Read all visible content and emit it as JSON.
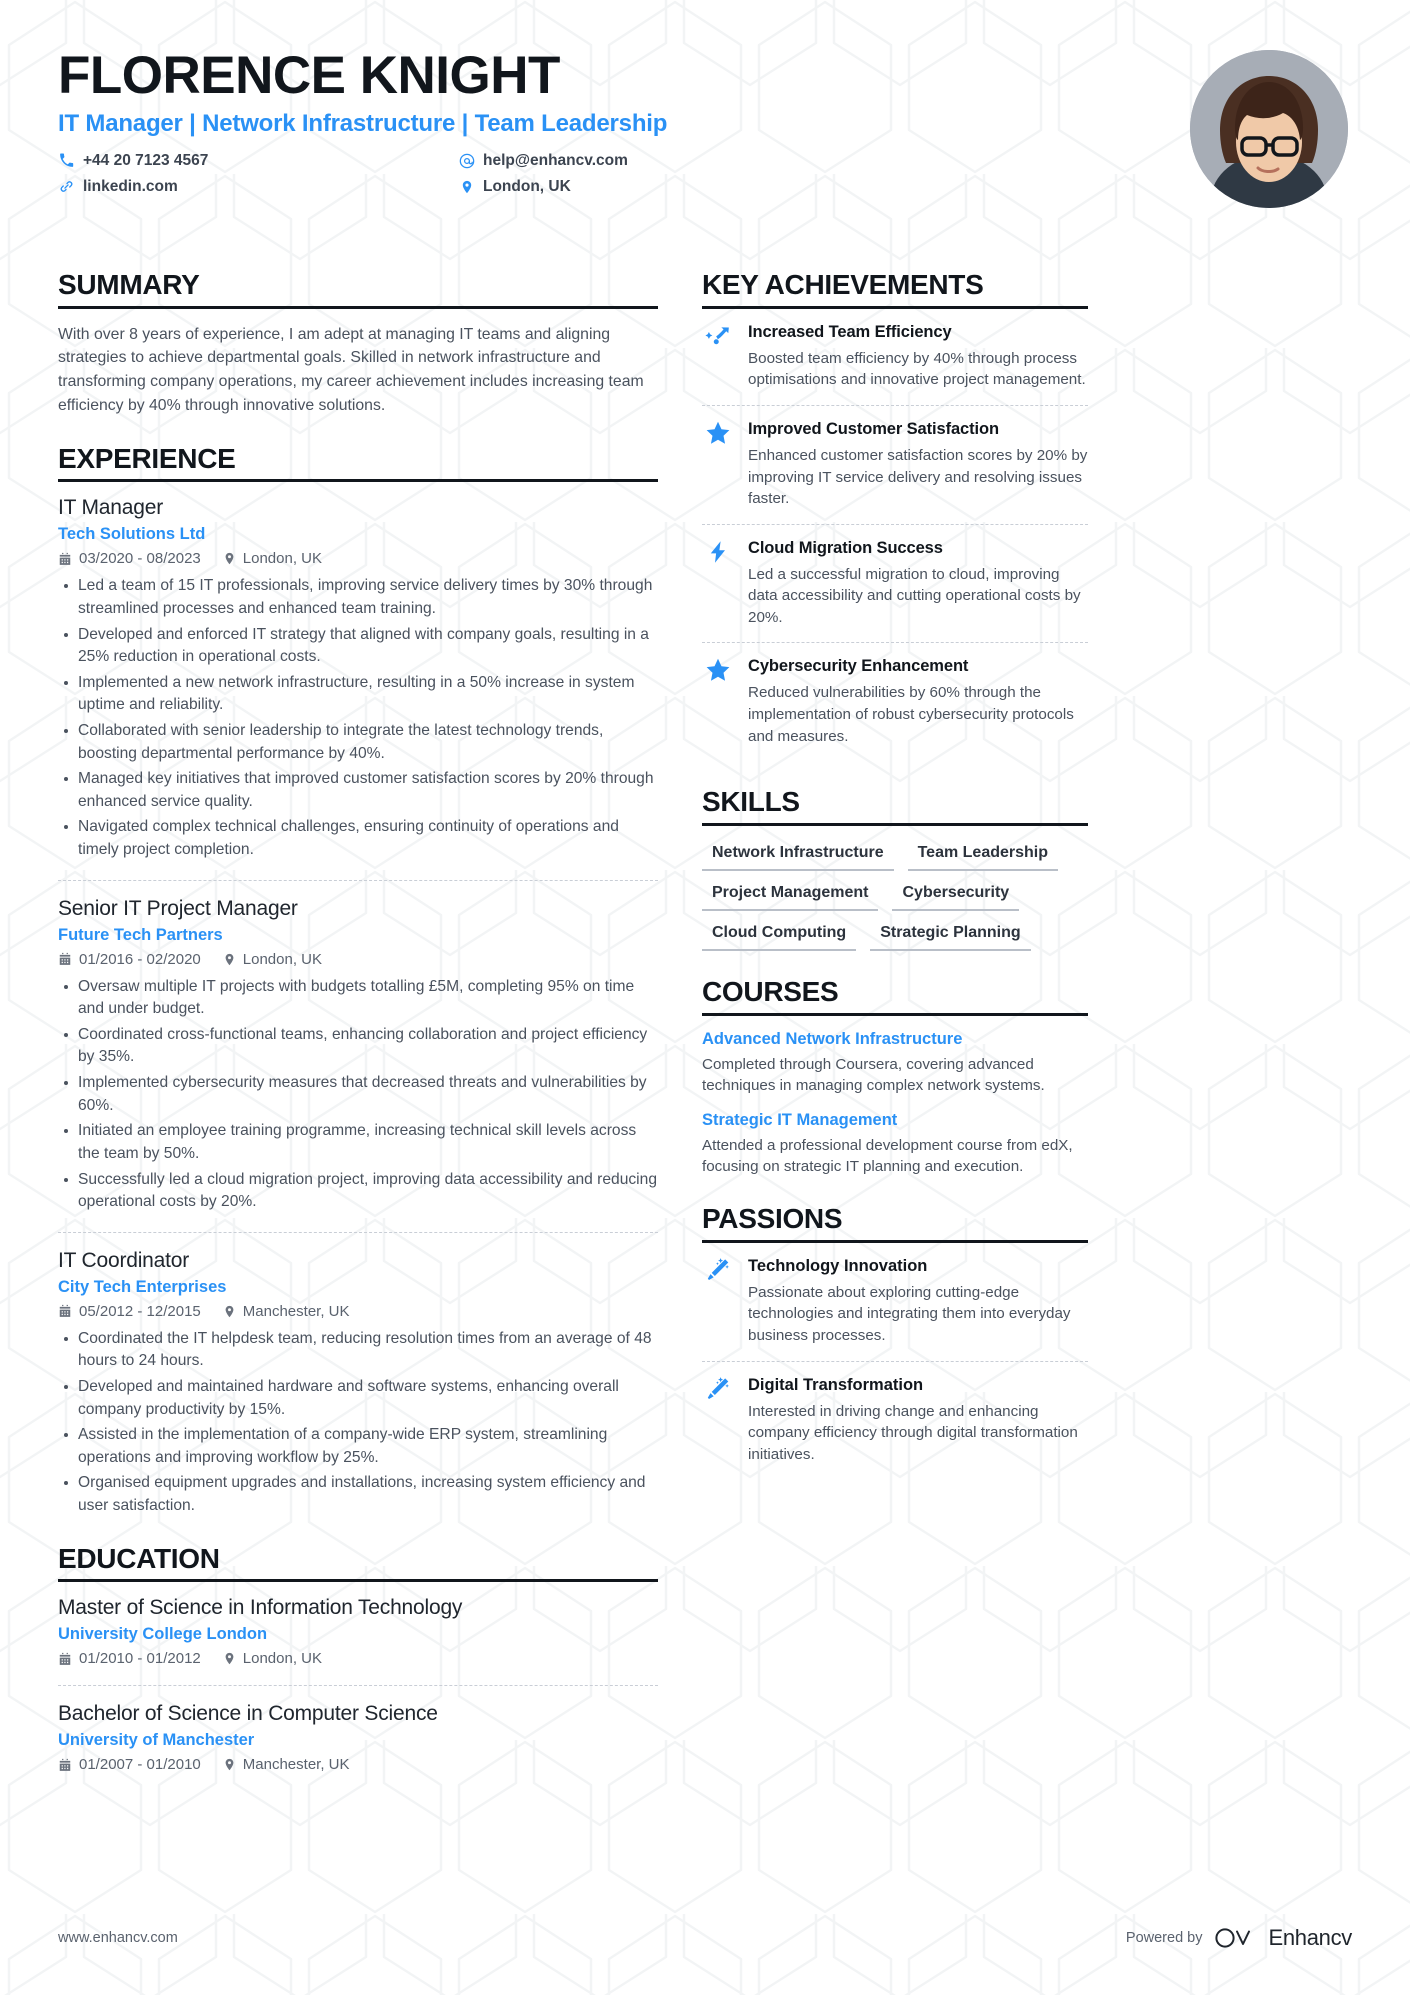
{
  "header": {
    "name": "FLORENCE KNIGHT",
    "headline": "IT Manager | Network Infrastructure | Team Leadership",
    "contacts": [
      {
        "icon": "phone-icon",
        "text": "+44 20 7123 4567"
      },
      {
        "icon": "email-icon",
        "text": "help@enhancv.com"
      },
      {
        "icon": "link-icon",
        "text": "linkedin.com"
      },
      {
        "icon": "location-pin-icon",
        "text": "London, UK"
      }
    ]
  },
  "summary": {
    "title": "SUMMARY",
    "text": "With over 8 years of experience, I am adept at managing IT teams and aligning strategies to achieve departmental goals. Skilled in network infrastructure and transforming company operations, my career achievement includes increasing team efficiency by 40% through innovative solutions."
  },
  "experience": {
    "title": "EXPERIENCE",
    "entries": [
      {
        "role": "IT Manager",
        "company": "Tech Solutions Ltd",
        "dates": "03/2020 - 08/2023",
        "location": "London, UK",
        "bullets": [
          "Led a team of 15 IT professionals, improving service delivery times by 30% through streamlined processes and enhanced team training.",
          "Developed and enforced IT strategy that aligned with company goals, resulting in a 25% reduction in operational costs.",
          "Implemented a new network infrastructure, resulting in a 50% increase in system uptime and reliability.",
          "Collaborated with senior leadership to integrate the latest technology trends, boosting departmental performance by 40%.",
          "Managed key initiatives that improved customer satisfaction scores by 20% through enhanced service quality.",
          "Navigated complex technical challenges, ensuring continuity of operations and timely project completion."
        ]
      },
      {
        "role": "Senior IT Project Manager",
        "company": "Future Tech Partners",
        "dates": "01/2016 - 02/2020",
        "location": "London, UK",
        "bullets": [
          "Oversaw multiple IT projects with budgets totalling £5M, completing 95% on time and under budget.",
          "Coordinated cross-functional teams, enhancing collaboration and project efficiency by 35%.",
          "Implemented cybersecurity measures that decreased threats and vulnerabilities by 60%.",
          "Initiated an employee training programme, increasing technical skill levels across the team by 50%.",
          "Successfully led a cloud migration project, improving data accessibility and reducing operational costs by 20%."
        ]
      },
      {
        "role": "IT Coordinator",
        "company": "City Tech Enterprises",
        "dates": "05/2012 - 12/2015",
        "location": "Manchester, UK",
        "bullets": [
          "Coordinated the IT helpdesk team, reducing resolution times from an average of 48 hours to 24 hours.",
          "Developed and maintained hardware and software systems, enhancing overall company productivity by 15%.",
          "Assisted in the implementation of a company-wide ERP system, streamlining operations and improving workflow by 25%.",
          "Organised equipment upgrades and installations, increasing system efficiency and user satisfaction."
        ]
      }
    ]
  },
  "education": {
    "title": "EDUCATION",
    "entries": [
      {
        "degree": "Master of Science in Information Technology",
        "school": "University College London",
        "dates": "01/2010 - 01/2012",
        "location": "London, UK"
      },
      {
        "degree": "Bachelor of Science in Computer Science",
        "school": "University of Manchester",
        "dates": "01/2007 - 01/2010",
        "location": "Manchester, UK"
      }
    ]
  },
  "achievements": {
    "title": "KEY ACHIEVEMENTS",
    "items": [
      {
        "icon": "growth-arrow-icon",
        "title": "Increased Team Efficiency",
        "desc": "Boosted team efficiency by 40% through process optimisations and innovative project management."
      },
      {
        "icon": "star-icon",
        "title": "Improved Customer Satisfaction",
        "desc": "Enhanced customer satisfaction scores by 20% by improving IT service delivery and resolving issues faster."
      },
      {
        "icon": "lightning-bolt-icon",
        "title": "Cloud Migration Success",
        "desc": "Led a successful migration to cloud, improving data accessibility and cutting operational costs by 20%."
      },
      {
        "icon": "star-icon",
        "title": "Cybersecurity Enhancement",
        "desc": "Reduced vulnerabilities by 60% through the implementation of robust cybersecurity protocols and measures."
      }
    ]
  },
  "skills": {
    "title": "SKILLS",
    "items": [
      "Network Infrastructure",
      "Team Leadership",
      "Project Management",
      "Cybersecurity",
      "Cloud Computing",
      "Strategic Planning"
    ]
  },
  "courses": {
    "title": "COURSES",
    "items": [
      {
        "name": "Advanced Network Infrastructure",
        "desc": "Completed through Coursera, covering advanced techniques in managing complex network systems."
      },
      {
        "name": "Strategic IT Management",
        "desc": "Attended a professional development course from edX, focusing on strategic IT planning and execution."
      }
    ]
  },
  "passions": {
    "title": "PASSIONS",
    "items": [
      {
        "icon": "magic-wand-icon",
        "title": "Technology Innovation",
        "desc": "Passionate about exploring cutting-edge technologies and integrating them into everyday business processes."
      },
      {
        "icon": "magic-wand-icon",
        "title": "Digital Transformation",
        "desc": "Interested in driving change and enhancing company efficiency through digital transformation initiatives."
      }
    ]
  },
  "footer": {
    "website": "www.enhancv.com",
    "powered_by": "Powered by",
    "brand": "Enhancv"
  },
  "colors": {
    "accent": "#2a91f5",
    "heading": "#11161c",
    "body": "#4a525e"
  }
}
